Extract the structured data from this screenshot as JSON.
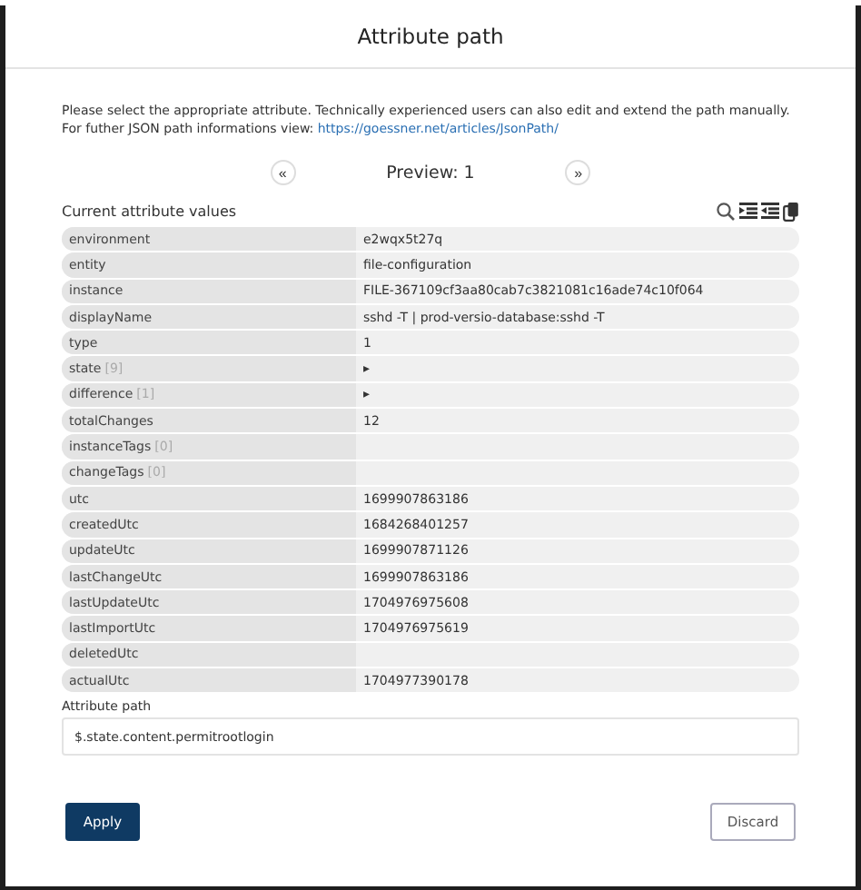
{
  "dialog": {
    "title": "Attribute path"
  },
  "intro": {
    "text": "Please select the appropriate attribute. Technically experienced users can also edit and extend the path manually. For futher JSON path informations view: ",
    "link": "https://goessner.net/articles/JsonPath/"
  },
  "pager": {
    "prev": "«",
    "label": "Preview: 1",
    "next": "»"
  },
  "values": {
    "heading": "Current attribute values",
    "rows": [
      {
        "key": "environment",
        "value": "e2wqx5t27q"
      },
      {
        "key": "entity",
        "value": "file-configuration"
      },
      {
        "key": "instance",
        "value": "FILE-367109cf3aa80cab7c3821081c16ade74c10f064"
      },
      {
        "key": "displayName",
        "value": "sshd -T | prod-versio-database:sshd -T"
      },
      {
        "key": "type",
        "value": "1"
      },
      {
        "key": "state",
        "count": "[9]",
        "value": "▸"
      },
      {
        "key": "difference",
        "count": "[1]",
        "value": "▸"
      },
      {
        "key": "totalChanges",
        "value": "12"
      },
      {
        "key": "instanceTags",
        "count": "[0]"
      },
      {
        "key": "changeTags",
        "count": "[0]"
      },
      {
        "key": "utc",
        "value": "1699907863186"
      },
      {
        "key": "createdUtc",
        "value": "1684268401257"
      },
      {
        "key": "updateUtc",
        "value": "1699907871126"
      },
      {
        "key": "lastChangeUtc",
        "value": "1699907863186"
      },
      {
        "key": "lastUpdateUtc",
        "value": "1704976975608"
      },
      {
        "key": "lastImportUtc",
        "value": "1704976975619"
      },
      {
        "key": "deletedUtc"
      },
      {
        "key": "actualUtc",
        "value": "1704977390178"
      }
    ]
  },
  "path_field": {
    "label": "Attribute path",
    "value": "$.state.content.permitrootlogin"
  },
  "buttons": {
    "apply": "Apply",
    "discard": "Discard"
  }
}
